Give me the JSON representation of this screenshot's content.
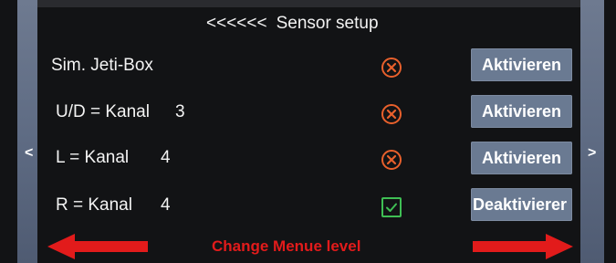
{
  "header": {
    "back_chevrons": "<<<<<<",
    "title": "Sensor setup"
  },
  "nav": {
    "left_arrow": "<",
    "right_arrow": ">"
  },
  "rows": [
    {
      "label": "Sim. Jeti-Box",
      "value": "",
      "status": "inactive",
      "button_label": "Aktivieren"
    },
    {
      "label": "U/D = Kanal",
      "value": "3",
      "status": "inactive",
      "button_label": "Aktivieren"
    },
    {
      "label": "L = Kanal",
      "value": "4",
      "status": "inactive",
      "button_label": "Aktivieren"
    },
    {
      "label": "R = Kanal",
      "value": "4",
      "status": "active",
      "button_label": "Deaktivierer"
    }
  ],
  "footer": {
    "text": "Change Menue level"
  },
  "colors": {
    "background": "#121315",
    "button": "#6a7a92",
    "inactive_icon": "#e8602c",
    "active_icon": "#3fbf54",
    "footer_red": "#e21b1b"
  },
  "icons": {
    "inactive": "x-circle-icon",
    "active": "checkbox-checked-icon",
    "footer_left": "arrow-left-icon",
    "footer_right": "arrow-right-icon"
  }
}
